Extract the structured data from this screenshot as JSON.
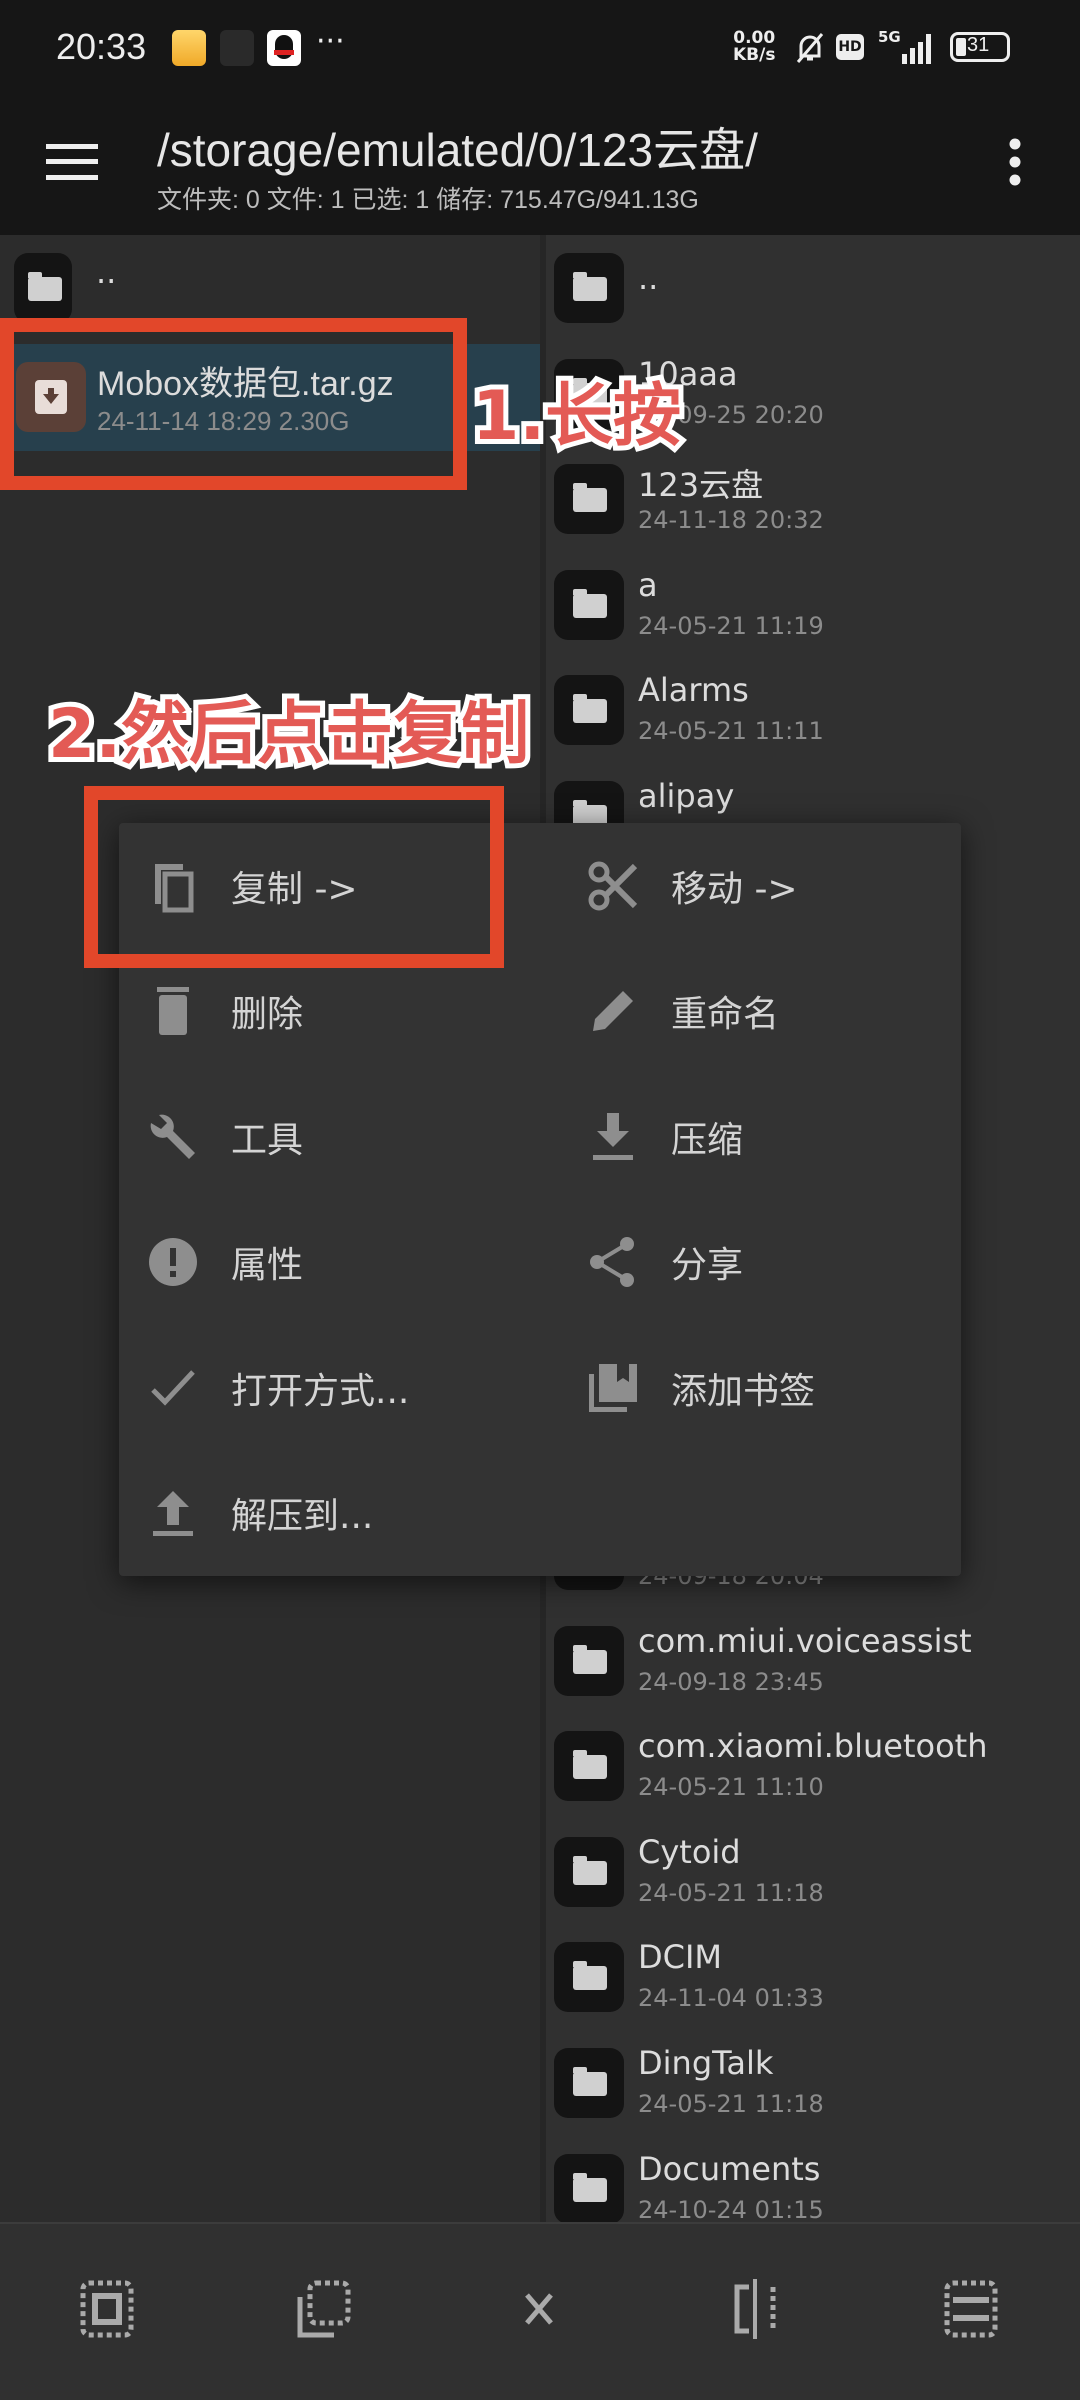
{
  "status_bar": {
    "time": "20:33",
    "net_speed": "0.00\nKB/s",
    "net_speed_top": "0.00",
    "net_speed_bottom": "KB/s",
    "hd": "HD",
    "network": "5G",
    "battery": "31",
    "more": "···"
  },
  "app_bar": {
    "path": "/storage/emulated/0/123云盘/",
    "stats": "文件夹: 0  文件: 1  已选: 1  储存: 715.47G/941.13G"
  },
  "left_pane": {
    "items": [
      {
        "name": ".."
      },
      {
        "name": "Mobox数据包.tar.gz",
        "date": "24-11-14 18:29  2.30G",
        "selected": true
      }
    ]
  },
  "right_pane": {
    "items_top": [
      {
        "name": ".."
      },
      {
        "name": "10aaa",
        "date": "24-09-25 20:20"
      },
      {
        "name": "123云盘",
        "date": "24-11-18 20:32"
      },
      {
        "name": "a",
        "date": "24-05-21 11:19"
      },
      {
        "name": "Alarms",
        "date": "24-05-21 11:11"
      },
      {
        "name": "alipay",
        "date": ""
      }
    ],
    "items_bottom": [
      {
        "name": "",
        "date": "24-09-18 20:04"
      },
      {
        "name": "com.miui.voiceassist",
        "date": "24-09-18 23:45"
      },
      {
        "name": "com.xiaomi.bluetooth",
        "date": "24-05-21 11:10"
      },
      {
        "name": "Cytoid",
        "date": "24-05-21 11:18"
      },
      {
        "name": "DCIM",
        "date": "24-11-04 01:33"
      },
      {
        "name": "DingTalk",
        "date": "24-05-21 11:18"
      },
      {
        "name": "Documents",
        "date": "24-10-24 01:15"
      }
    ]
  },
  "context_menu": {
    "items": [
      {
        "label": "复制 ->",
        "icon": "copy-icon"
      },
      {
        "label": "移动 ->",
        "icon": "scissors-icon"
      },
      {
        "label": "删除",
        "icon": "trash-icon"
      },
      {
        "label": "重命名",
        "icon": "pencil-icon"
      },
      {
        "label": "工具",
        "icon": "wrench-icon"
      },
      {
        "label": "压缩",
        "icon": "download-icon"
      },
      {
        "label": "属性",
        "icon": "info-alert-icon"
      },
      {
        "label": "分享",
        "icon": "share-icon"
      },
      {
        "label": "打开方式...",
        "icon": "check-icon"
      },
      {
        "label": "添加书签",
        "icon": "bookmark-icon"
      },
      {
        "label": "解压到...",
        "icon": "upload-icon"
      }
    ]
  },
  "bottom_bar": {
    "icons": [
      "select-inverse-icon",
      "select-range-icon",
      "close-icon",
      "split-pane-icon",
      "select-all-icon"
    ]
  },
  "annotations": {
    "step1": "1.长按",
    "step2": "2.然后点击复制",
    "highlight_color": "#e2472a",
    "text_color": "#e35a55"
  },
  "colors": {
    "selected_row": "#27404d",
    "file_icon_bg": "#5b4037",
    "background": "#2e2e2e"
  }
}
